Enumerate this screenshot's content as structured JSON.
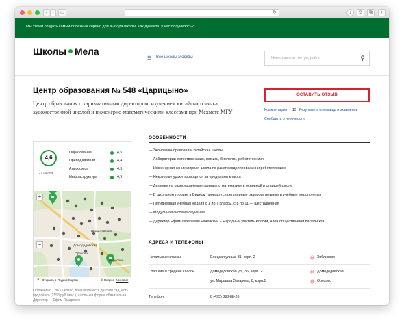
{
  "banner": {
    "text": "Мы хотим создать самый полезный сервис для выбора школы. Как думаете, у нас получилось?"
  },
  "header": {
    "logo_left": "Школы",
    "logo_right": "Мела",
    "nav_link": "Все школы Москвы",
    "search_placeholder": "Номер школы, метро, район"
  },
  "school": {
    "title": "Центр образования № 548 «Царицыно»",
    "description": "Центр образования с харизматичным директором, изучением китайского языка, художественной школой и инженерно-математическими классами при Мехмате МГУ",
    "review_button": "ОСТАВИТЬ ОТЗЫВ",
    "comments_label": "Комментарии",
    "comments_count": "13",
    "olympiad_link": "Результаты олимпиад и экзаменов",
    "report_link": "Сообщить о неточности"
  },
  "ratings": {
    "overall": "4,6",
    "reviews": "27 оценок",
    "items": [
      {
        "label": "Образование",
        "value": "4,5",
        "color": "#1d9b37"
      },
      {
        "label": "Преподаватели",
        "value": "4,4",
        "color": "#1d9b37"
      },
      {
        "label": "Атмосфера",
        "value": "4,5",
        "color": "#1d9b37"
      },
      {
        "label": "Инфраструктура",
        "value": "4,9",
        "color": "#1d9b37"
      }
    ]
  },
  "map": {
    "labels": [
      "Шипиловская",
      "Домодедовская",
      "Орехово",
      "Борисово"
    ],
    "open_link": "Открыть в Яндекс.Картах",
    "copyright": "© Яндекс",
    "terms": "Условия",
    "zoom_in": "+",
    "zoom_out": "−"
  },
  "card_text": "Обучение с 1 по 11 класс, при школе есть детский сад, есть продлёнка (2558 руб./мес.), школьная форма обязательна. Директор — Ефим Лазаревич",
  "features": {
    "title": "ОСОБЕННОСТИ",
    "items": [
      "— Экономико-правовая и китайская школы",
      "— Лаборатории естествознания, физики, биологии, робототехники",
      "— Инженерная каникулярная школа по ракетомоделированию и робототехнике",
      "— Некоторые уроки проводятся за пределами класса",
      "— Деление на разноуровневые группы по математике в основной и старшей школе",
      "— В школьном городке в Видном проводятся регулярные оздоровительные и учебные мероприятия",
      "— Пятидневная учебная неделя с 1 по 7 классы, с 8 по 11 — шестидневная",
      "— Модульная система обучения",
      "— Директор Ефим Лазаревич Рачевский – Народный учитель России, член общественной палаты РФ"
    ]
  },
  "addresses": {
    "title": "АДРЕСА И ТЕЛЕФОНЫ",
    "rows": [
      {
        "type": "Начальные классы",
        "address": "Елецкая улица, 31, корп. 2",
        "metro": "Зябликово"
      },
      {
        "type": "Старшие и средние классы",
        "address": "Домодедовская ул., 35, корп. 2",
        "metro": "Домодедовская"
      },
      {
        "type": "",
        "address": "ул. Маршала Захарова, 8, корп.1",
        "metro": "Орехово"
      }
    ],
    "phone_label": "Телефон",
    "phone": "8 (495) 398-88-26"
  },
  "colors": {
    "brand_green": "#006e2e",
    "accent_red": "#d4242f",
    "link_blue": "#2a5aa5",
    "rating_green": "#1d9b37"
  }
}
